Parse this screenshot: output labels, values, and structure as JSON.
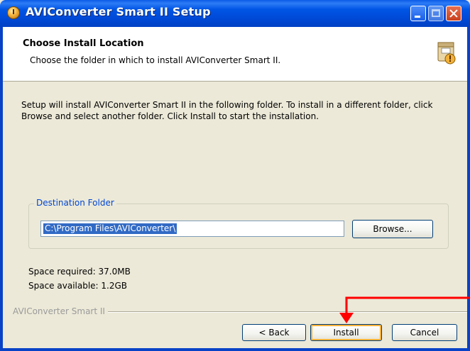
{
  "window": {
    "title": "AVIConverter Smart II Setup"
  },
  "header": {
    "title": "Choose Install Location",
    "subtitle": "Choose the folder in which to install AVIConverter Smart II."
  },
  "body": {
    "description": "Setup will install AVIConverter Smart II in the following folder. To install in a different folder, click Browse and select another folder. Click Install to start the installation."
  },
  "destination": {
    "group_label": "Destination Folder",
    "path": "C:\\Program Files\\AVIConverter\\",
    "browse_label": "Browse..."
  },
  "space": {
    "required": "Space required: 37.0MB",
    "available": "Space available: 1.2GB"
  },
  "footer": {
    "brand": "AVIConverter Smart II",
    "back_label": "< Back",
    "install_label": "Install",
    "cancel_label": "Cancel"
  },
  "colors": {
    "titlebar": "#0055e5",
    "annotation_arrow": "#ff0000",
    "selection": "#316ac5"
  },
  "icons": {
    "title": "setup-disc-icon",
    "header": "installer-box-icon"
  }
}
